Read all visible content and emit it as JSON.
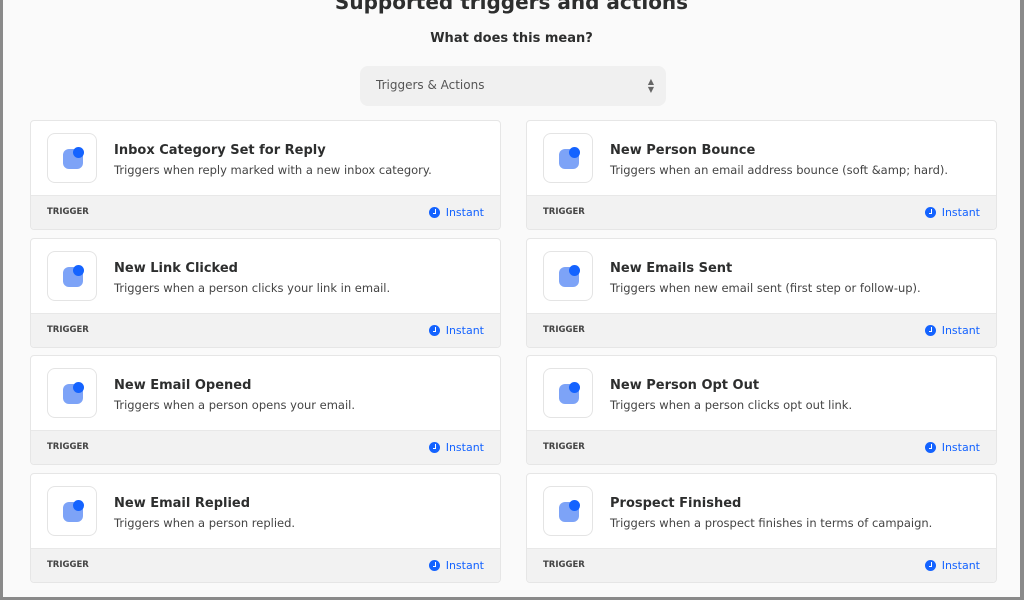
{
  "header": {
    "title": "Supported triggers and actions",
    "subtitle": "What does this mean?"
  },
  "filter": {
    "selected": "Triggers & Actions"
  },
  "colors": {
    "accent": "#1463ff",
    "icon_blob": "#7da3f7"
  },
  "cards": [
    {
      "name": "Inbox Category Set for Reply",
      "desc": "Triggers when reply marked with a new inbox category.",
      "type": "TRIGGER",
      "badge": "Instant"
    },
    {
      "name": "New Person Bounce",
      "desc": "Triggers when an email address bounce (soft &amp; hard).",
      "type": "TRIGGER",
      "badge": "Instant"
    },
    {
      "name": "New Link Clicked",
      "desc": "Triggers when a person clicks your link in email.",
      "type": "TRIGGER",
      "badge": "Instant"
    },
    {
      "name": "New Emails Sent",
      "desc": "Triggers when new email sent (first step or follow-up).",
      "type": "TRIGGER",
      "badge": "Instant"
    },
    {
      "name": "New Email Opened",
      "desc": "Triggers when a person opens your email.",
      "type": "TRIGGER",
      "badge": "Instant"
    },
    {
      "name": "New Person Opt Out",
      "desc": "Triggers when a person clicks opt out link.",
      "type": "TRIGGER",
      "badge": "Instant"
    },
    {
      "name": "New Email Replied",
      "desc": "Triggers when a person replied.",
      "type": "TRIGGER",
      "badge": "Instant"
    },
    {
      "name": "Prospect Finished",
      "desc": "Triggers when a prospect finishes in terms of campaign.",
      "type": "TRIGGER",
      "badge": "Instant"
    }
  ]
}
